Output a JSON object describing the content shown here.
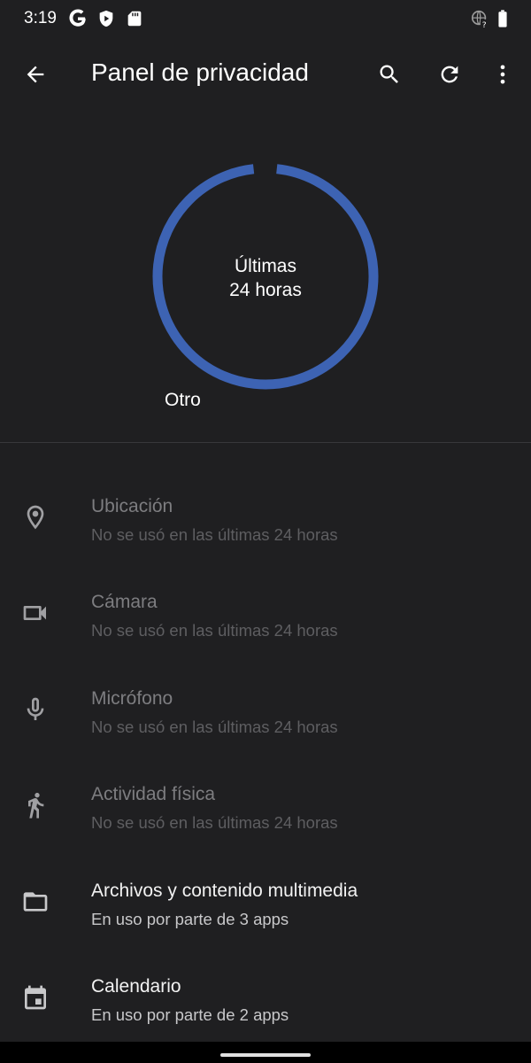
{
  "status_bar": {
    "time": "3:19",
    "icons_left": [
      "google-icon",
      "play-protect-icon",
      "sd-card-icon"
    ],
    "icons_right": [
      "globe-question-icon",
      "battery-icon"
    ]
  },
  "app_bar": {
    "title": "Panel de privacidad",
    "icons": [
      "back-arrow-icon",
      "search-icon",
      "refresh-icon",
      "more-vert-icon"
    ]
  },
  "chart": {
    "center_line1": "Últimas",
    "center_line2": "24 horas",
    "legend_label": "Otro",
    "segment_color": "#3d63b3",
    "track_color": "#2a2a2d"
  },
  "permissions": [
    {
      "icon": "location-pin-icon",
      "title": "Ubicación",
      "subtitle": "No se usó en las últimas 24 horas",
      "active": false
    },
    {
      "icon": "camera-icon",
      "title": "Cámara",
      "subtitle": "No se usó en las últimas 24 horas",
      "active": false
    },
    {
      "icon": "microphone-icon",
      "title": "Micrófono",
      "subtitle": "No se usó en las últimas 24 horas",
      "active": false
    },
    {
      "icon": "physical-activity-icon",
      "title": "Actividad física",
      "subtitle": "No se usó en las últimas 24 horas",
      "active": false
    },
    {
      "icon": "folder-icon",
      "title": "Archivos y contenido multimedia",
      "subtitle": "En uso por parte de 3 apps",
      "active": true
    },
    {
      "icon": "calendar-icon",
      "title": "Calendario",
      "subtitle": "En uso por parte de 2 apps",
      "active": true
    }
  ]
}
